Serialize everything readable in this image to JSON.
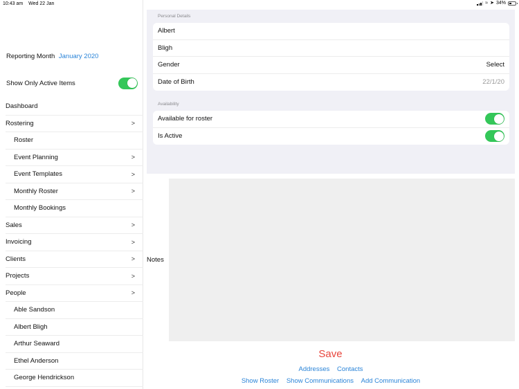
{
  "status_bar": {
    "time": "10:43 am",
    "date": "Wed 22 Jan",
    "battery_percent": "34%",
    "icons": [
      "signal-icon",
      "wifi-icon",
      "location-icon",
      "battery-icon"
    ]
  },
  "sidebar": {
    "reporting_label": "Reporting Month",
    "reporting_value": "January 2020",
    "active_filter_label": "Show Only Active Items",
    "active_filter_on": true,
    "chevron": ">",
    "items": [
      {
        "label": "Dashboard",
        "level": 0,
        "has_children": false
      },
      {
        "label": "Rostering",
        "level": 0,
        "has_children": true
      },
      {
        "label": "Roster",
        "level": 1,
        "has_children": false
      },
      {
        "label": "Event Planning",
        "level": 1,
        "has_children": true
      },
      {
        "label": "Event Templates",
        "level": 1,
        "has_children": true
      },
      {
        "label": "Monthly Roster",
        "level": 1,
        "has_children": true
      },
      {
        "label": "Monthly Bookings",
        "level": 1,
        "has_children": false
      },
      {
        "label": "Sales",
        "level": 0,
        "has_children": true
      },
      {
        "label": "Invoicing",
        "level": 0,
        "has_children": true
      },
      {
        "label": "Clients",
        "level": 0,
        "has_children": true
      },
      {
        "label": "Projects",
        "level": 0,
        "has_children": true
      },
      {
        "label": "People",
        "level": 0,
        "has_children": true
      },
      {
        "label": "Able Sandson",
        "level": 1,
        "has_children": false
      },
      {
        "label": "Albert Bligh",
        "level": 1,
        "has_children": false
      },
      {
        "label": "Arthur Seaward",
        "level": 1,
        "has_children": false
      },
      {
        "label": "Ethel Anderson",
        "level": 1,
        "has_children": false
      },
      {
        "label": "George  Hendrickson",
        "level": 1,
        "has_children": false
      }
    ]
  },
  "form": {
    "personal_details": {
      "header": "Personal Details",
      "first_name": "Albert",
      "last_name": "Bligh",
      "gender_label": "Gender",
      "gender_value": "Select",
      "dob_label": "Date of Birth",
      "dob_value": "22/1/20"
    },
    "availability": {
      "header": "Availability",
      "available_label": "Available for roster",
      "available_on": true,
      "active_label": "Is Active",
      "active_on": true
    },
    "notes": {
      "label": "Notes",
      "value": ""
    }
  },
  "actions": {
    "save": "Save",
    "addresses": "Addresses",
    "contacts": "Contacts",
    "show_roster": "Show Roster",
    "show_communications": "Show Communications",
    "add_communication": "Add Communication"
  },
  "colors": {
    "accent": "#2a84d8",
    "save": "#e8453c",
    "toggle_on": "#34c759"
  }
}
